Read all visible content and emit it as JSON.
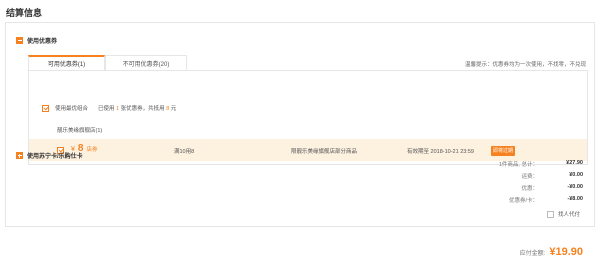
{
  "page_title": "结算信息",
  "coupon_section": {
    "title": "使用优惠券",
    "tabs": [
      {
        "label": "可用优惠券(1)",
        "active": true
      },
      {
        "label": "不可用优惠券(20)",
        "active": false
      }
    ],
    "hint": "温馨提示：优惠券均为一次使用，不找零，不兑现",
    "combo": {
      "checked": true,
      "label": "使用最优组合",
      "used_prefix": "已使用",
      "used_count": "1",
      "used_mid": "张优惠券，共抵用",
      "used_amount": "8",
      "used_suffix": "元"
    },
    "store_name": "靓乐美缘旗舰店(1)",
    "coupon": {
      "checked": true,
      "currency": "¥",
      "amount": "8",
      "type": "店券",
      "condition": "满10用8",
      "scope": "限靓乐美缘旗舰店部分商品",
      "valid": "有效期至 2018-10-21 23:59",
      "tag": "即将过期"
    }
  },
  "card_section": {
    "title": "使用苏宁卡/乐购仕卡"
  },
  "summary": [
    {
      "label": "1件商品, 总计：",
      "value": "¥27.90"
    },
    {
      "label": "运费：",
      "value": "¥0.00"
    },
    {
      "label": "优惠：",
      "value": "-¥0.00"
    },
    {
      "label": "优惠券/卡：",
      "value": "-¥8.00"
    }
  ],
  "proxy_pay": {
    "label": "找人代付",
    "checked": false
  },
  "total": {
    "label": "应付金额:",
    "value": "¥19.90"
  },
  "colors": {
    "accent": "#f5821f",
    "highlight_row": "#fdf1e0",
    "border": "#e6e6e6"
  }
}
